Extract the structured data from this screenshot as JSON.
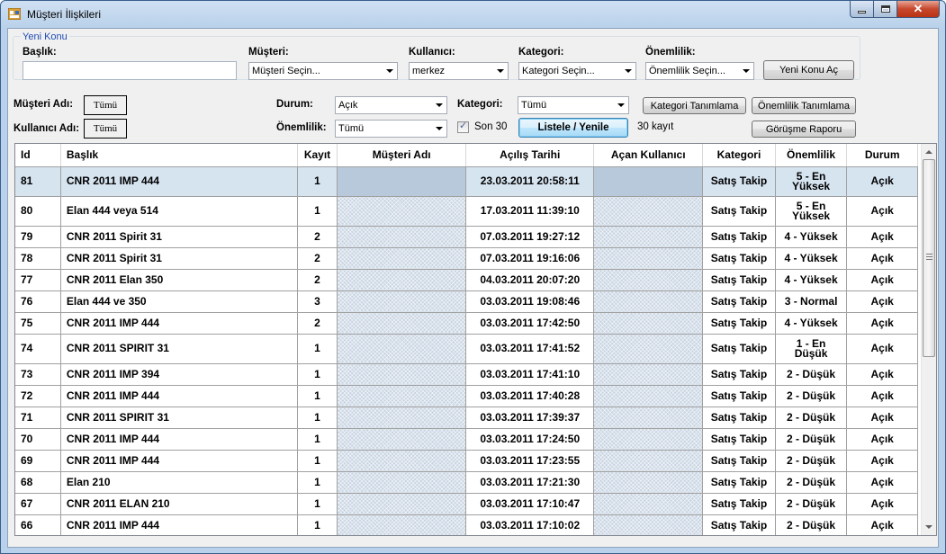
{
  "window": {
    "title": "Müşteri İlişkileri"
  },
  "new_topic": {
    "legend": "Yeni Konu",
    "title_label": "Başlık:",
    "title_value": "",
    "customer_label": "Müşteri:",
    "customer_value": "Müşteri Seçin...",
    "user_label": "Kullanıcı:",
    "user_value": "merkez",
    "category_label": "Kategori:",
    "category_value": "Kategori Seçin...",
    "importance_label": "Önemlilik:",
    "importance_value": "Önemlilik Seçin...",
    "open_button": "Yeni Konu Aç"
  },
  "filters": {
    "customer_name_label": "Müşteri Adı:",
    "customer_name_button": "Tümü",
    "user_name_label": "Kullanıcı Adı:",
    "user_name_button": "Tümü",
    "status_label": "Durum:",
    "status_value": "Açık",
    "importance_label": "Önemlilik:",
    "importance_value": "Tümü",
    "category_label": "Kategori:",
    "category_value": "Tümü",
    "last30_label": "Son 30",
    "last30_checked": true,
    "list_button": "Listele / Yenile",
    "record_count": "30 kayıt",
    "category_def_button": "Kategori Tanımlama",
    "importance_def_button": "Önemlilik Tanımlama",
    "meeting_report_button": "Görüşme Raporu"
  },
  "grid": {
    "columns": [
      "Id",
      "Başlık",
      "Kayıt",
      "Müşteri Adı",
      "Açılış Tarihi",
      "Açan Kullanıcı",
      "Kategori",
      "Önemlilik",
      "Durum"
    ],
    "rows": [
      {
        "id": "81",
        "title": "CNR 2011   IMP  444",
        "count": "1",
        "customer": "",
        "opened": "23.03.2011 20:58:11",
        "opener": "",
        "category": "Satış Takip",
        "importance": "5 - En Yüksek",
        "status": "Açık"
      },
      {
        "id": "80",
        "title": "Elan 444 veya 514",
        "count": "1",
        "customer": "",
        "opened": "17.03.2011 11:39:10",
        "opener": "",
        "category": "Satış Takip",
        "importance": "5 - En Yüksek",
        "status": "Açık"
      },
      {
        "id": "79",
        "title": "CNR 2011 Spirit 31",
        "count": "2",
        "customer": "",
        "opened": "07.03.2011 19:27:12",
        "opener": "",
        "category": "Satış Takip",
        "importance": "4 - Yüksek",
        "status": "Açık"
      },
      {
        "id": "78",
        "title": "CNR 2011 Spirit 31",
        "count": "2",
        "customer": "",
        "opened": "07.03.2011 19:16:06",
        "opener": "",
        "category": "Satış Takip",
        "importance": "4 - Yüksek",
        "status": "Açık"
      },
      {
        "id": "77",
        "title": "CNR 2011 Elan 350",
        "count": "2",
        "customer": "",
        "opened": "04.03.2011 20:07:20",
        "opener": "",
        "category": "Satış Takip",
        "importance": "4 - Yüksek",
        "status": "Açık"
      },
      {
        "id": "76",
        "title": "Elan 444 ve 350",
        "count": "3",
        "customer": "",
        "opened": "03.03.2011 19:08:46",
        "opener": "",
        "category": "Satış Takip",
        "importance": "3 - Normal",
        "status": "Açık"
      },
      {
        "id": "75",
        "title": "CNR 2011 IMP 444",
        "count": "2",
        "customer": "",
        "opened": "03.03.2011 17:42:50",
        "opener": "",
        "category": "Satış Takip",
        "importance": "4 - Yüksek",
        "status": "Açık"
      },
      {
        "id": "74",
        "title": "CNR 2011 SPIRIT 31",
        "count": "1",
        "customer": "",
        "opened": "03.03.2011 17:41:52",
        "opener": "",
        "category": "Satış Takip",
        "importance": "1 - En Düşük",
        "status": "Açık"
      },
      {
        "id": "73",
        "title": "CNR 2011 IMP 394",
        "count": "1",
        "customer": "",
        "opened": "03.03.2011 17:41:10",
        "opener": "",
        "category": "Satış Takip",
        "importance": "2 - Düşük",
        "status": "Açık"
      },
      {
        "id": "72",
        "title": "CNR 2011 IMP 444",
        "count": "1",
        "customer": "",
        "opened": "03.03.2011 17:40:28",
        "opener": "",
        "category": "Satış Takip",
        "importance": "2 - Düşük",
        "status": "Açık"
      },
      {
        "id": "71",
        "title": "CNR 2011 SPIRIT 31",
        "count": "1",
        "customer": "",
        "opened": "03.03.2011 17:39:37",
        "opener": "",
        "category": "Satış Takip",
        "importance": "2 - Düşük",
        "status": "Açık"
      },
      {
        "id": "70",
        "title": "CNR 2011 IMP 444",
        "count": "1",
        "customer": "",
        "opened": "03.03.2011 17:24:50",
        "opener": "",
        "category": "Satış Takip",
        "importance": "2 - Düşük",
        "status": "Açık"
      },
      {
        "id": "69",
        "title": "CNR 2011 IMP 444",
        "count": "1",
        "customer": "",
        "opened": "03.03.2011 17:23:55",
        "opener": "",
        "category": "Satış Takip",
        "importance": "2 - Düşük",
        "status": "Açık"
      },
      {
        "id": "68",
        "title": "Elan 210",
        "count": "1",
        "customer": "",
        "opened": "03.03.2011 17:21:30",
        "opener": "",
        "category": "Satış Takip",
        "importance": "2 - Düşük",
        "status": "Açık"
      },
      {
        "id": "67",
        "title": "CNR 2011 ELAN 210",
        "count": "1",
        "customer": "",
        "opened": "03.03.2011 17:10:47",
        "opener": "",
        "category": "Satış Takip",
        "importance": "2 - Düşük",
        "status": "Açık"
      },
      {
        "id": "66",
        "title": "CNR 2011 IMP 444",
        "count": "1",
        "customer": "",
        "opened": "03.03.2011 17:10:02",
        "opener": "",
        "category": "Satış Takip",
        "importance": "2 - Düşük",
        "status": "Açık"
      }
    ]
  }
}
